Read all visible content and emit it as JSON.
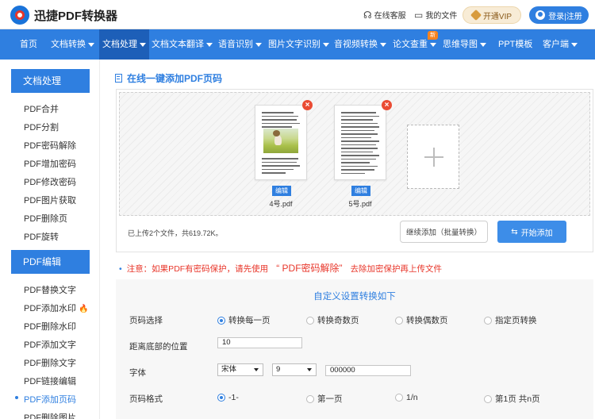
{
  "header": {
    "brand": "迅捷PDF转换器",
    "service_label": "在线客服",
    "docs_label": "我的文件",
    "vip_label": "开通VIP",
    "login_label": "登录|注册"
  },
  "nav": {
    "items": [
      {
        "label": "首页"
      },
      {
        "label": "文档转换"
      },
      {
        "label": "文档处理"
      },
      {
        "label": "文档文本翻译"
      },
      {
        "label": "语音识别"
      },
      {
        "label": "图片文字识别"
      },
      {
        "label": "音视频转换"
      },
      {
        "label": "论文查重"
      },
      {
        "label": "思维导图"
      },
      {
        "label": "PPT模板"
      },
      {
        "label": "客户端"
      }
    ],
    "badge": "新"
  },
  "sidebar": {
    "section1_title": "文档处理",
    "section1_items": [
      {
        "label": "PDF合并"
      },
      {
        "label": "PDF分割"
      },
      {
        "label": "PDF密码解除"
      },
      {
        "label": "PDF增加密码"
      },
      {
        "label": "PDF修改密码"
      },
      {
        "label": "PDF图片获取"
      },
      {
        "label": "PDF删除页"
      },
      {
        "label": "PDF旋转"
      }
    ],
    "section2_title": "PDF编辑",
    "section2_items": [
      {
        "label": "PDF替换文字"
      },
      {
        "label": "PDF添加水印"
      },
      {
        "label": "PDF删除水印"
      },
      {
        "label": "PDF添加文字"
      },
      {
        "label": "PDF删除文字"
      },
      {
        "label": "PDF链接编辑"
      },
      {
        "label": "PDF添加页码"
      },
      {
        "label": "PDF删除图片"
      }
    ]
  },
  "main": {
    "title": "在线一键添加PDF页码",
    "files": [
      {
        "name": "4号.pdf",
        "edit_label": "编辑",
        "delete": "×"
      },
      {
        "name": "5号.pdf",
        "edit_label": "编辑",
        "delete": "×"
      }
    ],
    "upload_info": "已上传2个文件，共619.72K。",
    "continue_label": "继续添加（批量转换）",
    "start_label": "开始添加",
    "notice_prefix": "注意：如果PDF有密码保护，请先使用",
    "notice_link": "“ PDF密码解除”",
    "notice_suffix": "去除加密保护再上传文件"
  },
  "settings": {
    "title": "自定义设置转换如下",
    "page_select_label": "页码选择",
    "page_select_options": [
      "转换每一页",
      "转换奇数页",
      "转换偶数页",
      "指定页转换"
    ],
    "page_select_selected": 0,
    "bottom_distance_label": "距离底部的位置",
    "bottom_distance_value": "10",
    "font_label": "字体",
    "font_family_value": "宋体",
    "font_size_value": "9",
    "font_color_value": "000000",
    "format_label": "页码格式",
    "format_options": [
      "-1-",
      "第一页",
      "1/n",
      "第1页 共n页"
    ],
    "format_selected": 0
  },
  "colors": {
    "accent": "#2f7fe0",
    "nav_active": "#1d5fb8",
    "warning": "#e8362a",
    "badge": "#f5831f"
  },
  "icons": {
    "headset": "headset-icon",
    "file": "file-icon",
    "gem": "gem-icon",
    "user": "user-icon",
    "fire": "fire-icon",
    "swap": "swap-icon",
    "plus": "plus-icon"
  }
}
